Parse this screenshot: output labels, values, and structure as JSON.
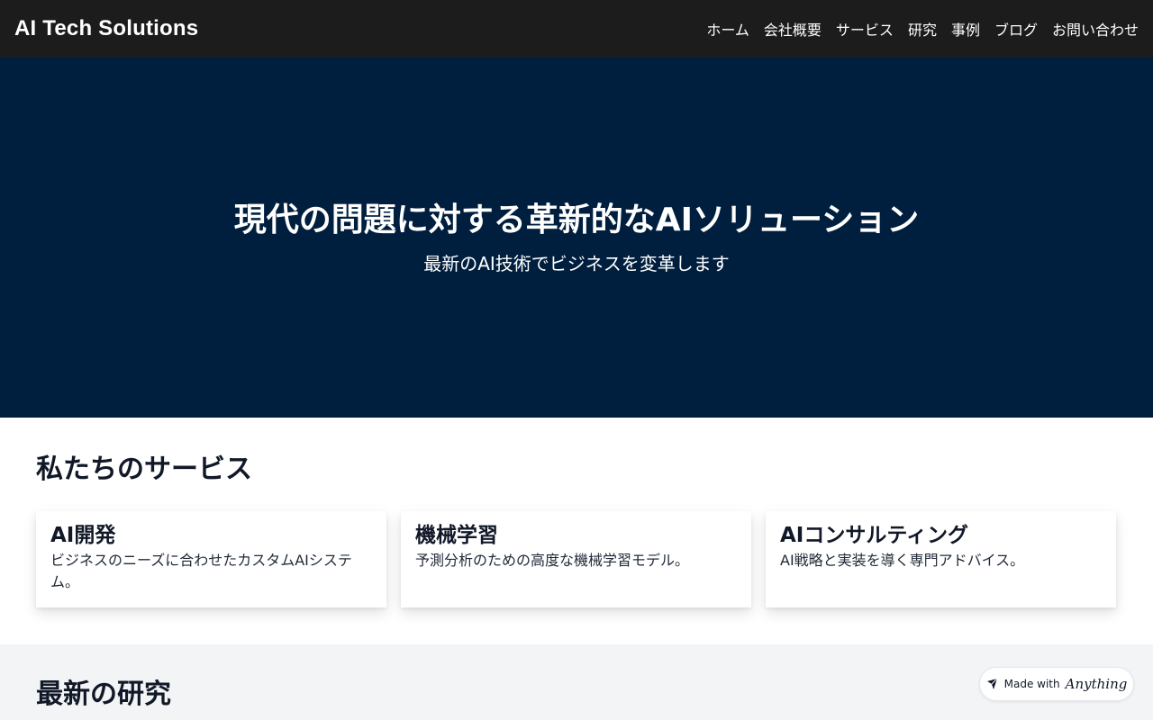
{
  "header": {
    "brand": "AI Tech Solutions",
    "nav": [
      "ホーム",
      "会社概要",
      "サービス",
      "研究",
      "事例",
      "ブログ",
      "お問い合わせ"
    ]
  },
  "hero": {
    "title": "現代の問題に対する革新的なAIソリューション",
    "subtitle": "最新のAI技術でビジネスを変革します"
  },
  "services": {
    "heading": "私たちのサービス",
    "cards": [
      {
        "title": "AI開発",
        "desc": "ビジネスのニーズに合わせたカスタムAIシステム。"
      },
      {
        "title": "機械学習",
        "desc": "予測分析のための高度な機械学習モデル。"
      },
      {
        "title": "AIコンサルティング",
        "desc": "AI戦略と実装を導く専門アドバイス。"
      }
    ]
  },
  "research": {
    "heading": "最新の研究"
  },
  "badge": {
    "prefix": "Made with",
    "brand": "Anything"
  },
  "colors": {
    "header_bg": "#1c1c1c",
    "hero_bg": "#001f3f",
    "research_bg": "#f3f4f6"
  }
}
